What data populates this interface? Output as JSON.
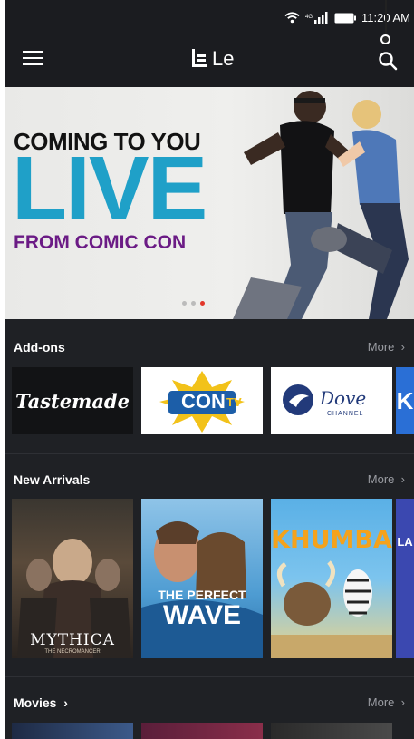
{
  "status": {
    "time": "11:20 AM",
    "network": "4G"
  },
  "appbar": {
    "logo_text": "Le"
  },
  "hero": {
    "line1": "COMING TO YOU",
    "line2": "LIVE",
    "line3": "FROM COMIC CON",
    "slide_count": 3,
    "active_slide": 3
  },
  "sections": {
    "addons": {
      "title": "Add-ons",
      "more": "More",
      "items": [
        {
          "label": "Tastemade"
        },
        {
          "label": "CON",
          "label2": "TV"
        },
        {
          "label": "Dove",
          "sub": "CHANNEL"
        },
        {
          "label": "K"
        }
      ]
    },
    "new_arrivals": {
      "title": "New Arrivals",
      "more": "More",
      "items": [
        {
          "title": "MYTHICA",
          "subtitle": "THE NECROMANCER"
        },
        {
          "title": "THE PERFECT",
          "title2": "WAVE"
        },
        {
          "title": "KHUMBA"
        },
        {
          "title": "LA"
        }
      ]
    },
    "movies": {
      "title": "Movies",
      "more": "More"
    }
  },
  "colors": {
    "background": "#1f2125",
    "bar": "#1b1c20",
    "live_blue": "#1fa0c8",
    "comic_purple": "#6b1b85",
    "active_dot": "#e2372a",
    "muted_text": "#9a9ca2"
  }
}
